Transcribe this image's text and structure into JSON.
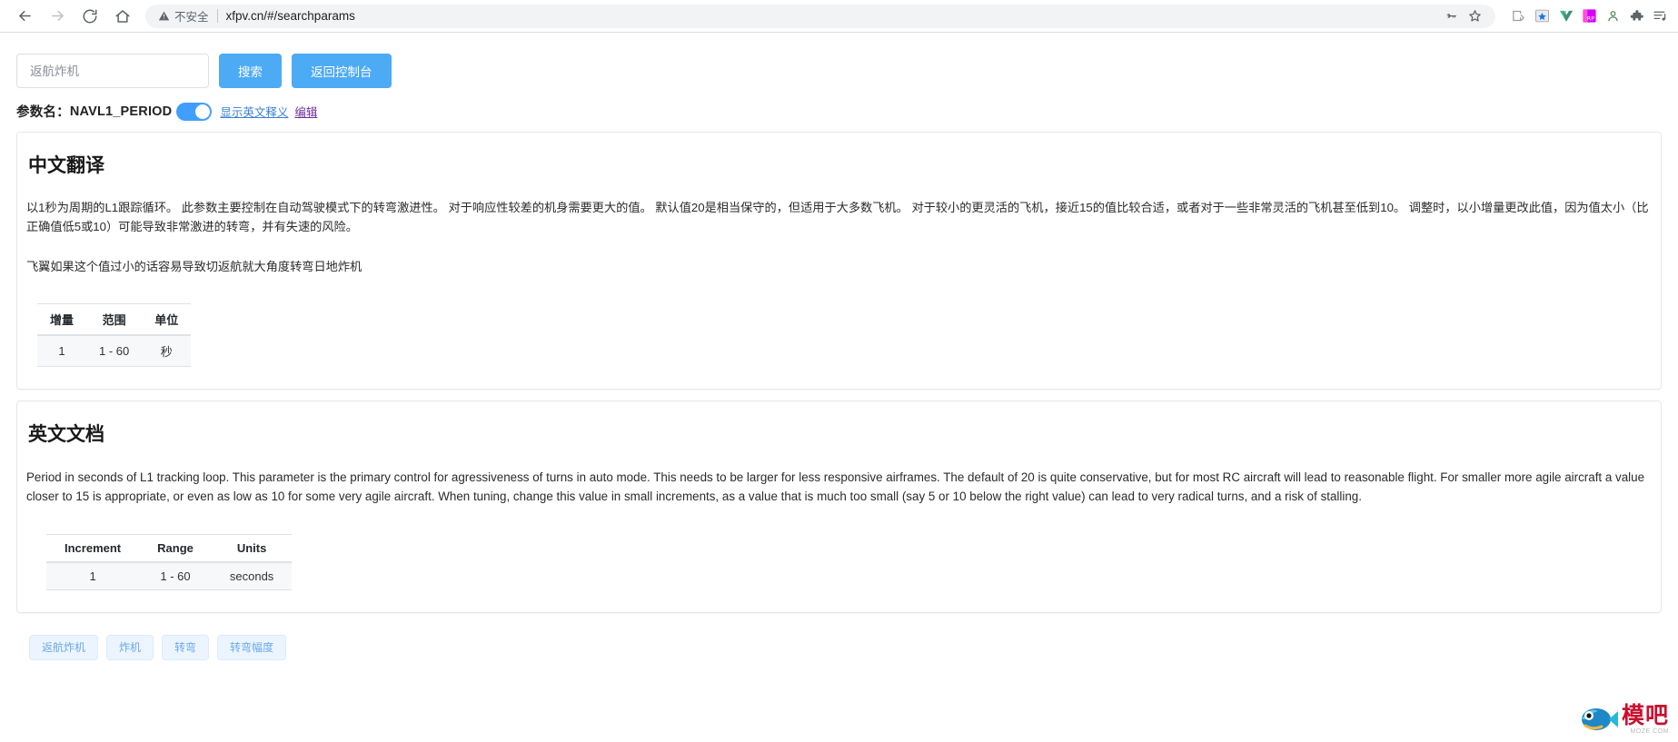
{
  "browser": {
    "nav": {
      "back": "back-arrow",
      "forward": "forward-arrow",
      "reload": "reload",
      "home": "home"
    },
    "security_label": "不安全",
    "url": "xfpv.cn/#/searchparams",
    "omni_icons": [
      "key-icon",
      "star-icon"
    ],
    "extensions": [
      "share-icon",
      "bookmark-star-icon",
      "vue-devtools-icon",
      "rp-icon",
      "user-profile-icon",
      "puzzle-icon",
      "menu-list-icon"
    ]
  },
  "search": {
    "input_value": "返航炸机",
    "placeholder": "返航炸机",
    "search_button": "搜索",
    "console_button": "返回控制台"
  },
  "param": {
    "label_prefix": "参数名：",
    "name": "NAVL1_PERIOD",
    "toggle_on": true,
    "show_english_link": "显示英文释义",
    "edit_link": "编辑"
  },
  "chinese_card": {
    "title": "中文翻译",
    "paragraph1": "以1秒为周期的L1跟踪循环。 此参数主要控制在自动驾驶模式下的转弯激进性。 对于响应性较差的机身需要更大的值。 默认值20是相当保守的，但适用于大多数飞机。 对于较小的更灵活的飞机，接近15的值比较合适，或者对于一些非常灵活的飞机甚至低到10。 调整时，以小增量更改此值，因为值太小（比正确值低5或10）可能导致非常激进的转弯，并有失速的风险。",
    "paragraph2": "飞翼如果这个值过小的话容易导致切返航就大角度转弯日地炸机",
    "table": {
      "headers": [
        "增量",
        "范围",
        "单位"
      ],
      "rows": [
        [
          "1",
          "1 - 60",
          "秒"
        ]
      ]
    }
  },
  "english_card": {
    "title": "英文文档",
    "paragraph": "Period in seconds of L1 tracking loop. This parameter is the primary control for agressiveness of turns in auto mode. This needs to be larger for less responsive airframes. The default of 20 is quite conservative, but for most RC aircraft will lead to reasonable flight. For smaller more agile aircraft a value closer to 15 is appropriate, or even as low as 10 for some very agile aircraft. When tuning, change this value in small increments, as a value that is much too small (say 5 or 10 below the right value) can lead to very radical turns, and a risk of stalling.",
    "table": {
      "headers": [
        "Increment",
        "Range",
        "Units"
      ],
      "rows": [
        [
          "1",
          "1 - 60",
          "seconds"
        ]
      ]
    }
  },
  "tags": [
    "返航炸机",
    "炸机",
    "转弯",
    "转弯幅度"
  ],
  "watermark": {
    "name": "模吧",
    "url": "MOZE.COM"
  },
  "colors": {
    "accent": "#4daaf5",
    "toggle_on": "#409eff",
    "link": "#3a7fd5",
    "visited": "#6c2fa0",
    "tag_bg": "#ecf5ff",
    "tag_text": "#6aa9e9",
    "watermark_red": "#c8102e"
  }
}
